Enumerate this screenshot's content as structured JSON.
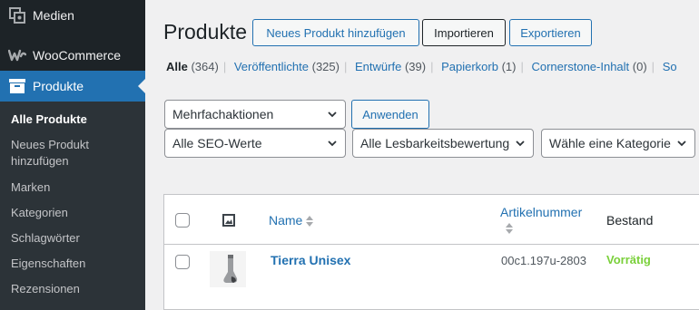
{
  "sidebar": {
    "menu": [
      {
        "label": "Medien",
        "icon": "media-icon"
      },
      {
        "label": "WooCommerce",
        "icon": "woocommerce-icon"
      },
      {
        "label": "Produkte",
        "icon": "archive-icon"
      }
    ],
    "submenu": [
      {
        "label": "Alle Produkte",
        "current": true
      },
      {
        "label": "Neues Produkt hinzufügen"
      },
      {
        "label": "Marken"
      },
      {
        "label": "Kategorien"
      },
      {
        "label": "Schlagwörter"
      },
      {
        "label": "Eigenschaften"
      },
      {
        "label": "Rezensionen"
      }
    ]
  },
  "header": {
    "title": "Produkte",
    "buttons": {
      "add_new": "Neues Produkt hinzufügen",
      "import": "Importieren",
      "export": "Exportieren"
    }
  },
  "views": [
    {
      "label": "Alle",
      "count": "(364)"
    },
    {
      "label": "Veröffentlichte",
      "count": "(325)"
    },
    {
      "label": "Entwürfe",
      "count": "(39)"
    },
    {
      "label": "Papierkorb",
      "count": "(1)"
    },
    {
      "label": "Cornerstone-Inhalt",
      "count": "(0)"
    },
    {
      "label": "So",
      "count": ""
    }
  ],
  "filters": {
    "bulk_actions": "Mehrfachaktionen",
    "apply": "Anwenden",
    "seo": "Alle SEO-Werte",
    "readability": "Alle Lesbarkeitsbewertungen",
    "category": "Wähle eine Kategorie"
  },
  "table": {
    "columns": {
      "name": "Name",
      "sku": "Artikelnummer",
      "stock": "Bestand"
    },
    "rows": [
      {
        "name": "Tierra Unisex",
        "sku": "00c1.197u-2803",
        "stock": "Vorrätig"
      }
    ]
  },
  "colors": {
    "accent": "#2271b1",
    "sidebar": "#1d2327",
    "submenu": "#2c3338",
    "in_stock": "#7ad03a"
  }
}
